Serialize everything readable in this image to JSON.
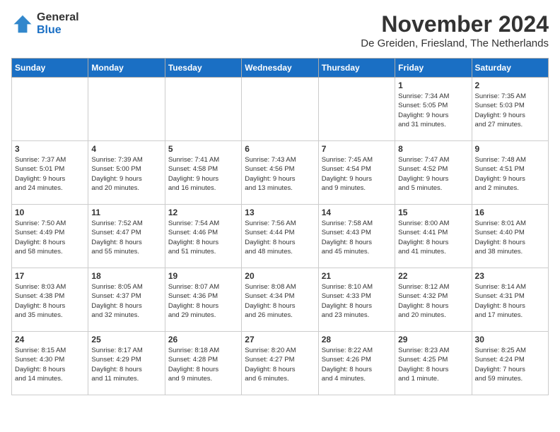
{
  "header": {
    "logo_general": "General",
    "logo_blue": "Blue",
    "month_title": "November 2024",
    "location": "De Greiden, Friesland, The Netherlands"
  },
  "weekdays": [
    "Sunday",
    "Monday",
    "Tuesday",
    "Wednesday",
    "Thursday",
    "Friday",
    "Saturday"
  ],
  "weeks": [
    {
      "days": [
        {
          "num": "",
          "info": ""
        },
        {
          "num": "",
          "info": ""
        },
        {
          "num": "",
          "info": ""
        },
        {
          "num": "",
          "info": ""
        },
        {
          "num": "",
          "info": ""
        },
        {
          "num": "1",
          "info": "Sunrise: 7:34 AM\nSunset: 5:05 PM\nDaylight: 9 hours\nand 31 minutes."
        },
        {
          "num": "2",
          "info": "Sunrise: 7:35 AM\nSunset: 5:03 PM\nDaylight: 9 hours\nand 27 minutes."
        }
      ]
    },
    {
      "days": [
        {
          "num": "3",
          "info": "Sunrise: 7:37 AM\nSunset: 5:01 PM\nDaylight: 9 hours\nand 24 minutes."
        },
        {
          "num": "4",
          "info": "Sunrise: 7:39 AM\nSunset: 5:00 PM\nDaylight: 9 hours\nand 20 minutes."
        },
        {
          "num": "5",
          "info": "Sunrise: 7:41 AM\nSunset: 4:58 PM\nDaylight: 9 hours\nand 16 minutes."
        },
        {
          "num": "6",
          "info": "Sunrise: 7:43 AM\nSunset: 4:56 PM\nDaylight: 9 hours\nand 13 minutes."
        },
        {
          "num": "7",
          "info": "Sunrise: 7:45 AM\nSunset: 4:54 PM\nDaylight: 9 hours\nand 9 minutes."
        },
        {
          "num": "8",
          "info": "Sunrise: 7:47 AM\nSunset: 4:52 PM\nDaylight: 9 hours\nand 5 minutes."
        },
        {
          "num": "9",
          "info": "Sunrise: 7:48 AM\nSunset: 4:51 PM\nDaylight: 9 hours\nand 2 minutes."
        }
      ]
    },
    {
      "days": [
        {
          "num": "10",
          "info": "Sunrise: 7:50 AM\nSunset: 4:49 PM\nDaylight: 8 hours\nand 58 minutes."
        },
        {
          "num": "11",
          "info": "Sunrise: 7:52 AM\nSunset: 4:47 PM\nDaylight: 8 hours\nand 55 minutes."
        },
        {
          "num": "12",
          "info": "Sunrise: 7:54 AM\nSunset: 4:46 PM\nDaylight: 8 hours\nand 51 minutes."
        },
        {
          "num": "13",
          "info": "Sunrise: 7:56 AM\nSunset: 4:44 PM\nDaylight: 8 hours\nand 48 minutes."
        },
        {
          "num": "14",
          "info": "Sunrise: 7:58 AM\nSunset: 4:43 PM\nDaylight: 8 hours\nand 45 minutes."
        },
        {
          "num": "15",
          "info": "Sunrise: 8:00 AM\nSunset: 4:41 PM\nDaylight: 8 hours\nand 41 minutes."
        },
        {
          "num": "16",
          "info": "Sunrise: 8:01 AM\nSunset: 4:40 PM\nDaylight: 8 hours\nand 38 minutes."
        }
      ]
    },
    {
      "days": [
        {
          "num": "17",
          "info": "Sunrise: 8:03 AM\nSunset: 4:38 PM\nDaylight: 8 hours\nand 35 minutes."
        },
        {
          "num": "18",
          "info": "Sunrise: 8:05 AM\nSunset: 4:37 PM\nDaylight: 8 hours\nand 32 minutes."
        },
        {
          "num": "19",
          "info": "Sunrise: 8:07 AM\nSunset: 4:36 PM\nDaylight: 8 hours\nand 29 minutes."
        },
        {
          "num": "20",
          "info": "Sunrise: 8:08 AM\nSunset: 4:34 PM\nDaylight: 8 hours\nand 26 minutes."
        },
        {
          "num": "21",
          "info": "Sunrise: 8:10 AM\nSunset: 4:33 PM\nDaylight: 8 hours\nand 23 minutes."
        },
        {
          "num": "22",
          "info": "Sunrise: 8:12 AM\nSunset: 4:32 PM\nDaylight: 8 hours\nand 20 minutes."
        },
        {
          "num": "23",
          "info": "Sunrise: 8:14 AM\nSunset: 4:31 PM\nDaylight: 8 hours\nand 17 minutes."
        }
      ]
    },
    {
      "days": [
        {
          "num": "24",
          "info": "Sunrise: 8:15 AM\nSunset: 4:30 PM\nDaylight: 8 hours\nand 14 minutes."
        },
        {
          "num": "25",
          "info": "Sunrise: 8:17 AM\nSunset: 4:29 PM\nDaylight: 8 hours\nand 11 minutes."
        },
        {
          "num": "26",
          "info": "Sunrise: 8:18 AM\nSunset: 4:28 PM\nDaylight: 8 hours\nand 9 minutes."
        },
        {
          "num": "27",
          "info": "Sunrise: 8:20 AM\nSunset: 4:27 PM\nDaylight: 8 hours\nand 6 minutes."
        },
        {
          "num": "28",
          "info": "Sunrise: 8:22 AM\nSunset: 4:26 PM\nDaylight: 8 hours\nand 4 minutes."
        },
        {
          "num": "29",
          "info": "Sunrise: 8:23 AM\nSunset: 4:25 PM\nDaylight: 8 hours\nand 1 minute."
        },
        {
          "num": "30",
          "info": "Sunrise: 8:25 AM\nSunset: 4:24 PM\nDaylight: 7 hours\nand 59 minutes."
        }
      ]
    }
  ]
}
